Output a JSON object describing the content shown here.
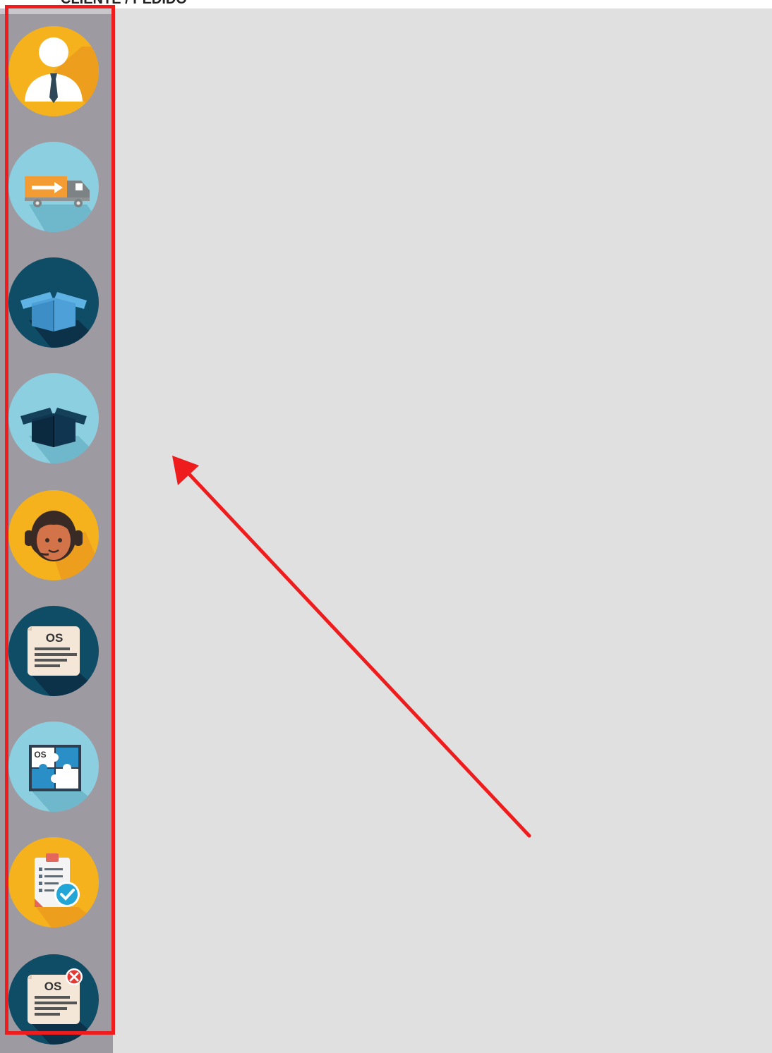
{
  "header": {
    "cropped_text": "CLIENTE / PEDIDO"
  },
  "sidebar": {
    "items": [
      {
        "name": "user-profile",
        "icon": "businessman-icon",
        "color": "#f5b21c"
      },
      {
        "name": "delivery",
        "icon": "delivery-truck-icon",
        "color": "#8ccfe0"
      },
      {
        "name": "box-open",
        "icon": "open-box-icon",
        "color": "#0f4c66"
      },
      {
        "name": "box-dark",
        "icon": "dark-box-icon",
        "color": "#8ccfe0"
      },
      {
        "name": "support",
        "icon": "support-headset-icon",
        "color": "#f5b21c"
      },
      {
        "name": "service-order",
        "icon": "service-order-document-icon",
        "color": "#0f4c66",
        "label": "OS"
      },
      {
        "name": "service-order-puzzle",
        "icon": "service-order-puzzle-icon",
        "color": "#8ccfe0",
        "label": "OS"
      },
      {
        "name": "checklist",
        "icon": "checklist-approved-icon",
        "color": "#f5b21c"
      },
      {
        "name": "service-order-cancel",
        "icon": "service-order-cancel-icon",
        "color": "#0f4c66",
        "label": "OS"
      }
    ]
  },
  "annotations": {
    "highlight_color": "#ee1c1c",
    "arrow_color": "#ee1c1c"
  }
}
